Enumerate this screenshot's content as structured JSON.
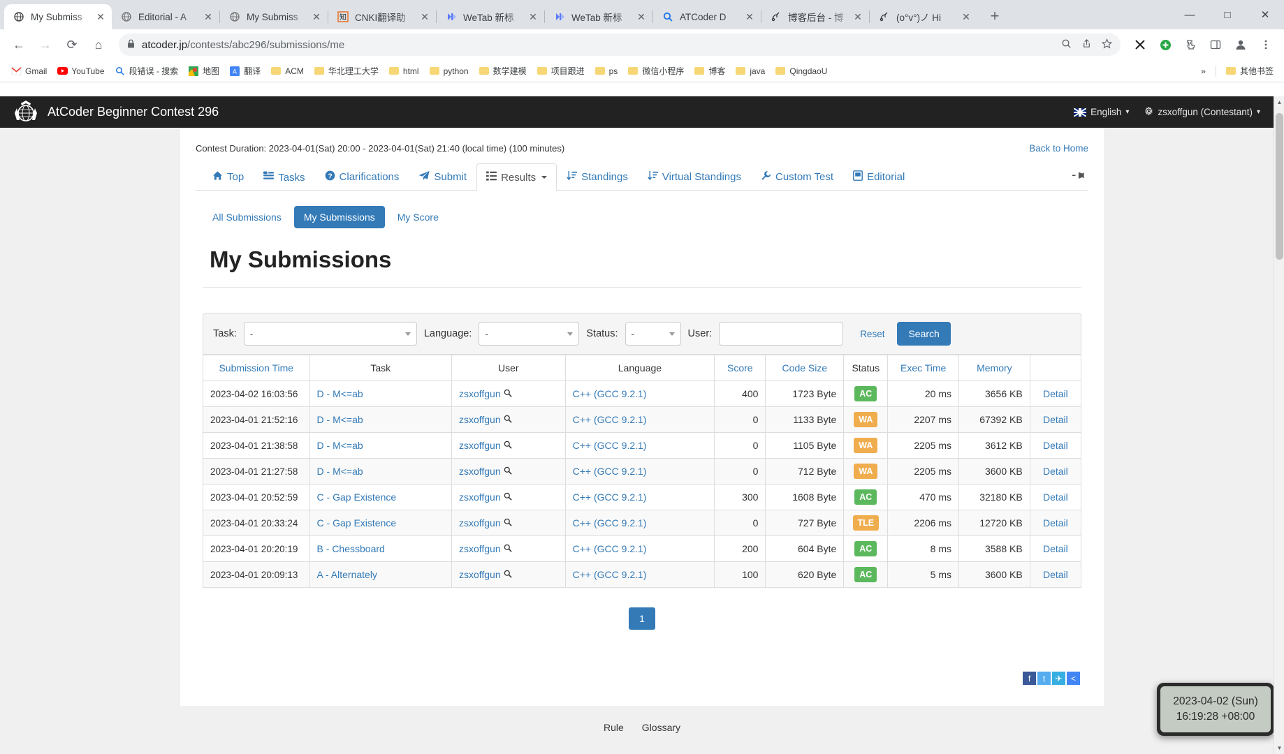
{
  "browser": {
    "tabs": [
      {
        "title": "My Submiss",
        "icon": "atcoder-icon",
        "active": true
      },
      {
        "title": "Editorial - A",
        "icon": "atcoder-icon",
        "active": false
      },
      {
        "title": "My Submiss",
        "icon": "atcoder-icon",
        "active": false
      },
      {
        "title": "CNKI翻译助",
        "icon": "cnki-icon",
        "active": false
      },
      {
        "title": "WeTab 新标",
        "icon": "wetab-icon",
        "active": false
      },
      {
        "title": "WeTab 新标",
        "icon": "wetab-icon",
        "active": false
      },
      {
        "title": "ATCoder D",
        "icon": "search-icon",
        "active": false
      },
      {
        "title": "博客后台 - 博",
        "icon": "blog-icon",
        "active": false
      },
      {
        "title": "(o°v°)ノ Hi",
        "icon": "blog-icon",
        "active": false
      }
    ],
    "new_tab_label": "+",
    "window_controls": {
      "minimize": "—",
      "maximize": "□",
      "close": "✕"
    },
    "nav": {
      "back": "←",
      "forward": "→",
      "reload": "⟳",
      "home": "⌂"
    },
    "omnibox": {
      "lock": "🔒",
      "host": "atcoder.jp",
      "path": "/contests/abc296/submissions/me",
      "full_url": "atcoder.jp/contests/abc296/submissions/me",
      "zoom_icon": "🔍",
      "share_icon": "↗",
      "bookmark_icon": "☆"
    },
    "toolbar_icons": [
      "x-extension-icon",
      "add-extension-icon",
      "puzzle-extension-icon",
      "sidepanel-icon",
      "profile-icon",
      "menu-icon"
    ],
    "bookmarks": [
      {
        "label": "Gmail",
        "icon": "gmail-icon"
      },
      {
        "label": "YouTube",
        "icon": "youtube-icon"
      },
      {
        "label": "段错误 - 搜索",
        "icon": "search-blue-icon"
      },
      {
        "label": "地图",
        "icon": "maps-icon"
      },
      {
        "label": "翻译",
        "icon": "translate-icon"
      },
      {
        "label": "ACM",
        "icon": "folder-icon"
      },
      {
        "label": "华北理工大学",
        "icon": "folder-icon"
      },
      {
        "label": "html",
        "icon": "folder-icon"
      },
      {
        "label": "python",
        "icon": "folder-icon"
      },
      {
        "label": "数学建模",
        "icon": "folder-icon"
      },
      {
        "label": "项目跟进",
        "icon": "folder-icon"
      },
      {
        "label": "ps",
        "icon": "folder-icon"
      },
      {
        "label": "微信小程序",
        "icon": "folder-icon"
      },
      {
        "label": "博客",
        "icon": "folder-icon"
      },
      {
        "label": "java",
        "icon": "folder-icon"
      },
      {
        "label": "QingdaoU",
        "icon": "folder-icon"
      }
    ],
    "bookmarks_overflow": "»",
    "other_bookmarks": "其他书签"
  },
  "site_header": {
    "contest_title": "AtCoder Beginner Contest 296",
    "language": "English",
    "user": "zsxoffgun (Contestant)",
    "logo_name": "atcoder-logo"
  },
  "contest": {
    "duration": "Contest Duration: 2023-04-01(Sat) 20:00 - 2023-04-01(Sat) 21:40 (local time) (100 minutes)",
    "back_to_home": "Back to Home",
    "nav_tabs": [
      {
        "label": "Top",
        "icon": "home-icon",
        "active": false
      },
      {
        "label": "Tasks",
        "icon": "list-icon",
        "active": false
      },
      {
        "label": "Clarifications",
        "icon": "question-icon",
        "active": false
      },
      {
        "label": "Submit",
        "icon": "send-icon",
        "active": false
      },
      {
        "label": "Results",
        "icon": "results-icon",
        "active": true,
        "caret": true
      },
      {
        "label": "Standings",
        "icon": "sort-icon",
        "active": false
      },
      {
        "label": "Virtual Standings",
        "icon": "sort-icon",
        "active": false
      },
      {
        "label": "Custom Test",
        "icon": "wrench-icon",
        "active": false
      },
      {
        "label": "Editorial",
        "icon": "book-icon",
        "active": false
      }
    ],
    "pin_icon": "pin-icon"
  },
  "subtabs": [
    {
      "label": "All Submissions",
      "active": false
    },
    {
      "label": "My Submissions",
      "active": true
    },
    {
      "label": "My Score",
      "active": false
    }
  ],
  "page_title": "My Submissions",
  "filters": {
    "task_label": "Task:",
    "task_value": "-",
    "language_label": "Language:",
    "language_value": "-",
    "status_label": "Status:",
    "status_value": "-",
    "user_label": "User:",
    "user_value": "",
    "user_placeholder": "",
    "reset_label": "Reset",
    "search_label": "Search"
  },
  "table": {
    "headers": [
      "Submission Time",
      "Task",
      "User",
      "Language",
      "Score",
      "Code Size",
      "Status",
      "Exec Time",
      "Memory",
      ""
    ],
    "rows": [
      {
        "time": "2023-04-02 16:03:56",
        "task": "D - M<=ab",
        "user": "zsxoffgun",
        "language": "C++ (GCC 9.2.1)",
        "score": "400",
        "code_size": "1723 Byte",
        "status": "AC",
        "exec_time": "20 ms",
        "memory": "3656 KB",
        "detail": "Detail"
      },
      {
        "time": "2023-04-01 21:52:16",
        "task": "D - M<=ab",
        "user": "zsxoffgun",
        "language": "C++ (GCC 9.2.1)",
        "score": "0",
        "code_size": "1133 Byte",
        "status": "WA",
        "exec_time": "2207 ms",
        "memory": "67392 KB",
        "detail": "Detail"
      },
      {
        "time": "2023-04-01 21:38:58",
        "task": "D - M<=ab",
        "user": "zsxoffgun",
        "language": "C++ (GCC 9.2.1)",
        "score": "0",
        "code_size": "1105 Byte",
        "status": "WA",
        "exec_time": "2205 ms",
        "memory": "3612 KB",
        "detail": "Detail"
      },
      {
        "time": "2023-04-01 21:27:58",
        "task": "D - M<=ab",
        "user": "zsxoffgun",
        "language": "C++ (GCC 9.2.1)",
        "score": "0",
        "code_size": "712 Byte",
        "status": "WA",
        "exec_time": "2205 ms",
        "memory": "3600 KB",
        "detail": "Detail"
      },
      {
        "time": "2023-04-01 20:52:59",
        "task": "C - Gap Existence",
        "user": "zsxoffgun",
        "language": "C++ (GCC 9.2.1)",
        "score": "300",
        "code_size": "1608 Byte",
        "status": "AC",
        "exec_time": "470 ms",
        "memory": "32180 KB",
        "detail": "Detail"
      },
      {
        "time": "2023-04-01 20:33:24",
        "task": "C - Gap Existence",
        "user": "zsxoffgun",
        "language": "C++ (GCC 9.2.1)",
        "score": "0",
        "code_size": "727 Byte",
        "status": "TLE",
        "exec_time": "2206 ms",
        "memory": "12720 KB",
        "detail": "Detail"
      },
      {
        "time": "2023-04-01 20:20:19",
        "task": "B - Chessboard",
        "user": "zsxoffgun",
        "language": "C++ (GCC 9.2.1)",
        "score": "200",
        "code_size": "604 Byte",
        "status": "AC",
        "exec_time": "8 ms",
        "memory": "3588 KB",
        "detail": "Detail"
      },
      {
        "time": "2023-04-01 20:09:13",
        "task": "A - Alternately",
        "user": "zsxoffgun",
        "language": "C++ (GCC 9.2.1)",
        "score": "100",
        "code_size": "620 Byte",
        "status": "AC",
        "exec_time": "5 ms",
        "memory": "3600 KB",
        "detail": "Detail"
      }
    ]
  },
  "pagination": {
    "current": "1"
  },
  "share": [
    {
      "name": "facebook-share",
      "glyph": "f"
    },
    {
      "name": "twitter-share",
      "glyph": "t"
    },
    {
      "name": "telegram-share",
      "glyph": "✈"
    },
    {
      "name": "more-share",
      "glyph": "<"
    }
  ],
  "footer": {
    "rule": "Rule",
    "glossary": "Glossary"
  },
  "clock": {
    "date": "2023-04-02 (Sun)",
    "time": "16:19:28 +08:00"
  },
  "colors": {
    "accent": "#337ab7",
    "ac": "#5cb85c",
    "wa": "#f0ad4e",
    "tle": "#f0ad4e",
    "header_bg": "#222222"
  }
}
